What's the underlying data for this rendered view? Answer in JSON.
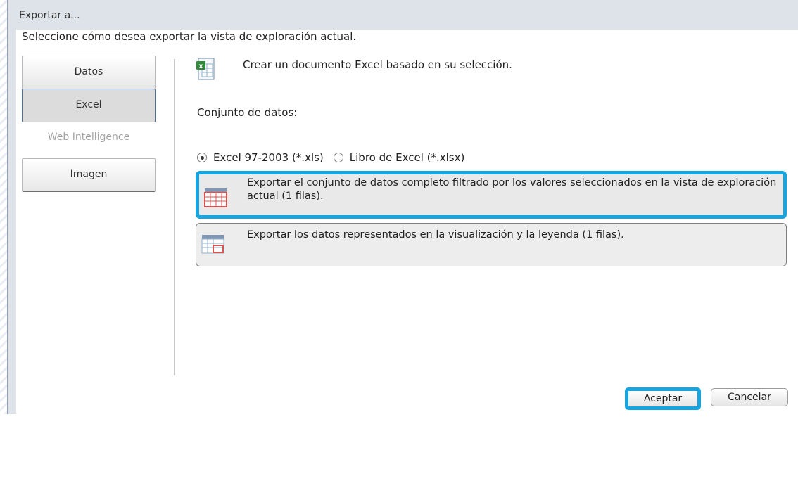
{
  "window": {
    "title": "Exportar a..."
  },
  "instruction": "Seleccione cómo desea exportar la vista de exploración actual.",
  "nav": {
    "items": [
      {
        "label": "Datos",
        "state": "normal"
      },
      {
        "label": "Excel",
        "state": "selected"
      },
      {
        "label": "Web Intelligence",
        "state": "disabled"
      },
      {
        "label": "Imagen",
        "state": "normal"
      }
    ]
  },
  "excel_panel": {
    "icon": "excel-file-icon",
    "description": "Crear un documento Excel basado en su selección.",
    "dataset_label": "Conjunto de datos:",
    "formats": [
      {
        "label": "Excel 97-2003 (*.xls)",
        "checked": true
      },
      {
        "label": "Libro de Excel (*.xlsx)",
        "checked": false
      }
    ],
    "options": [
      {
        "text": "Exportar el conjunto de datos completo filtrado por los valores seleccionados en la vista de exploración actual (1 filas).",
        "icon": "full-table-icon",
        "selected": true
      },
      {
        "text": "Exportar los datos representados en la visualización y la leyenda (1 filas).",
        "icon": "partial-table-icon",
        "selected": false
      }
    ]
  },
  "footer": {
    "accept_label": "Aceptar",
    "cancel_label": "Cancelar"
  },
  "colors": {
    "highlight": "#16a5df",
    "selected_nav_border": "#4d6f9c"
  }
}
